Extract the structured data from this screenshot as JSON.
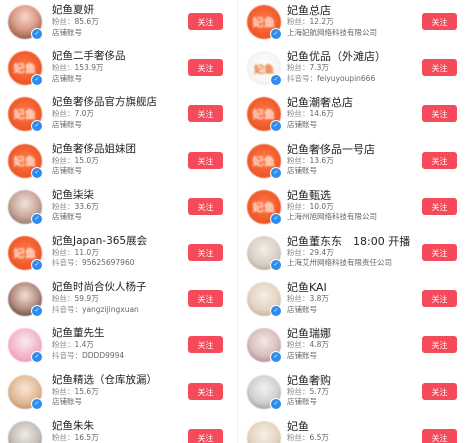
{
  "follow_label": "关注",
  "verify_badge": "✓",
  "labels": {
    "fans": "粉丝：",
    "shop": "店铺账号",
    "douyin": "抖音号："
  },
  "left": [
    {
      "name": "妃鱼夏妍",
      "fans": "85.6万",
      "sub_type": "shop",
      "sub": "店铺账号",
      "avatar_icon": "person-photo",
      "avatar_class": "photo-a",
      "logo_text": ""
    },
    {
      "name": "妃鱼二手奢侈品",
      "fans": "153.9万",
      "sub_type": "shop",
      "sub": "店铺账号",
      "avatar_icon": "feiyu-logo",
      "avatar_class": "logo",
      "logo_text": "妃鱼"
    },
    {
      "name": "妃鱼奢侈品官方旗舰店",
      "fans": "7.0万",
      "sub_type": "shop",
      "sub": "店铺账号",
      "avatar_icon": "feiyu-logo",
      "avatar_class": "logo",
      "logo_text": "妃鱼"
    },
    {
      "name": "妃鱼奢侈品姐妹团",
      "fans": "15.0万",
      "sub_type": "shop",
      "sub": "店铺账号",
      "avatar_icon": "feiyu-logo",
      "avatar_class": "logo",
      "logo_text": "妃鱼"
    },
    {
      "name": "妃鱼柒柒",
      "fans": "33.6万",
      "sub_type": "shop",
      "sub": "店铺账号",
      "avatar_icon": "person-photo",
      "avatar_class": "photo-b",
      "logo_text": ""
    },
    {
      "name": "妃鱼Japan-365展会",
      "fans": "11.0万",
      "sub_type": "douyin",
      "sub": "95625697960",
      "avatar_icon": "feiyu-logo",
      "avatar_class": "logo",
      "logo_text": "妃鱼"
    },
    {
      "name": "妃鱼时尚合伙人杨子",
      "fans": "59.9万",
      "sub_type": "douyin",
      "sub": "yangzijingxuan",
      "avatar_icon": "person-photo",
      "avatar_class": "photo-c",
      "logo_text": ""
    },
    {
      "name": "妃鱼董先生",
      "fans": "1.4万",
      "sub_type": "douyin",
      "sub": "DDDD9994",
      "avatar_icon": "person-photo",
      "avatar_class": "photo-d",
      "logo_text": ""
    },
    {
      "name": "妃鱼精选（仓库放漏）",
      "fans": "15.6万",
      "sub_type": "shop",
      "sub": "店铺账号",
      "avatar_icon": "person-photo",
      "avatar_class": "photo-e",
      "logo_text": ""
    },
    {
      "name": "妃鱼朱朱",
      "fans": "16.5万",
      "sub_type": "shop",
      "sub": "店铺账号",
      "avatar_icon": "person-photo",
      "avatar_class": "photo-f",
      "logo_text": ""
    }
  ],
  "right": [
    {
      "name": "妃鱼总店",
      "fans": "12.2万",
      "sub_type": "company",
      "sub": "上海妃航网络科技有限公司",
      "avatar_icon": "feiyu-logo",
      "avatar_class": "logo",
      "logo_text": "妃鱼"
    },
    {
      "name": "妃鱼优品（外滩店）",
      "fans": "7.3万",
      "sub_type": "douyin",
      "sub": "feiyuyoupin666",
      "avatar_icon": "feiyu-logo-white",
      "avatar_class": "logo-white",
      "logo_text": "妃鱼"
    },
    {
      "name": "妃鱼潮奢总店",
      "fans": "14.6万",
      "sub_type": "shop",
      "sub": "店铺账号",
      "avatar_icon": "feiyu-logo",
      "avatar_class": "logo",
      "logo_text": "妃鱼"
    },
    {
      "name": "妃鱼奢侈品一号店",
      "fans": "13.6万",
      "sub_type": "shop",
      "sub": "店铺账号",
      "avatar_icon": "feiyu-logo",
      "avatar_class": "logo",
      "logo_text": "妃鱼"
    },
    {
      "name": "妃鱼甄选",
      "fans": "10.0万",
      "sub_type": "company",
      "sub": "上海州旭网络科技有限公司",
      "avatar_icon": "feiyu-logo",
      "avatar_class": "logo",
      "logo_text": "妃鱼"
    },
    {
      "name": "妃鱼董东东　18:00 开播",
      "fans": "29.4万",
      "sub_type": "company",
      "sub": "上海艾卅网络科技有限责任公司",
      "avatar_icon": "person-photo",
      "avatar_class": "photo-g",
      "logo_text": ""
    },
    {
      "name": "妃鱼KAI",
      "fans": "3.8万",
      "sub_type": "shop",
      "sub": "店铺账号",
      "avatar_icon": "person-photo",
      "avatar_class": "photo-h",
      "logo_text": ""
    },
    {
      "name": "妃鱼瑞娜",
      "fans": "4.8万",
      "sub_type": "shop",
      "sub": "店铺账号",
      "avatar_icon": "person-photo",
      "avatar_class": "photo-i",
      "logo_text": ""
    },
    {
      "name": "妃鱼奢购",
      "fans": "5.7万",
      "sub_type": "shop",
      "sub": "店铺账号",
      "avatar_icon": "person-photo",
      "avatar_class": "photo-j",
      "logo_text": ""
    },
    {
      "name": "妃鱼",
      "fans": "6.5万",
      "sub_type": "shop",
      "sub": "店铺账号",
      "avatar_icon": "person-photo",
      "avatar_class": "photo-h",
      "logo_text": ""
    }
  ]
}
